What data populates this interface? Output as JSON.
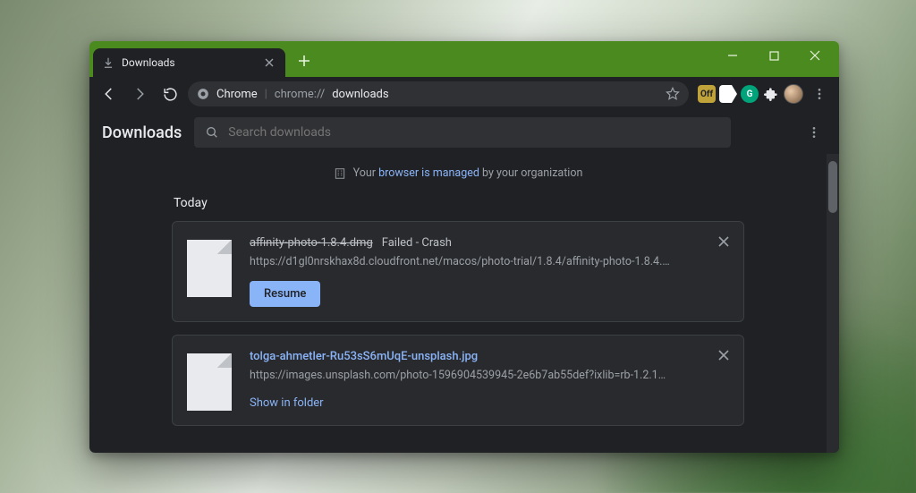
{
  "tab": {
    "title": "Downloads"
  },
  "omnibox": {
    "product": "Chrome",
    "url_prefix": "chrome://",
    "url_path": "downloads"
  },
  "page": {
    "title": "Downloads",
    "search_placeholder": "Search downloads",
    "managed": {
      "pre": "Your",
      "link": "browser is managed",
      "post": "by your organization"
    },
    "section": "Today"
  },
  "downloads": [
    {
      "filename": "affinity-photo-1.8.4.dmg",
      "status": "Failed - Crash",
      "url": "https://d1gl0nrskhax8d.cloudfront.net/macos/photo-trial/1.8.4/affinity-photo-1.8.4.d…",
      "action_label": "Resume",
      "failed": true
    },
    {
      "filename": "tolga-ahmetler-Ru53sS6mUqE-unsplash.jpg",
      "url": "https://images.unsplash.com/photo-1596904539945-2e6b7ab55def?ixlib=rb-1.2.1&q…",
      "action_label": "Show in folder",
      "failed": false
    }
  ]
}
